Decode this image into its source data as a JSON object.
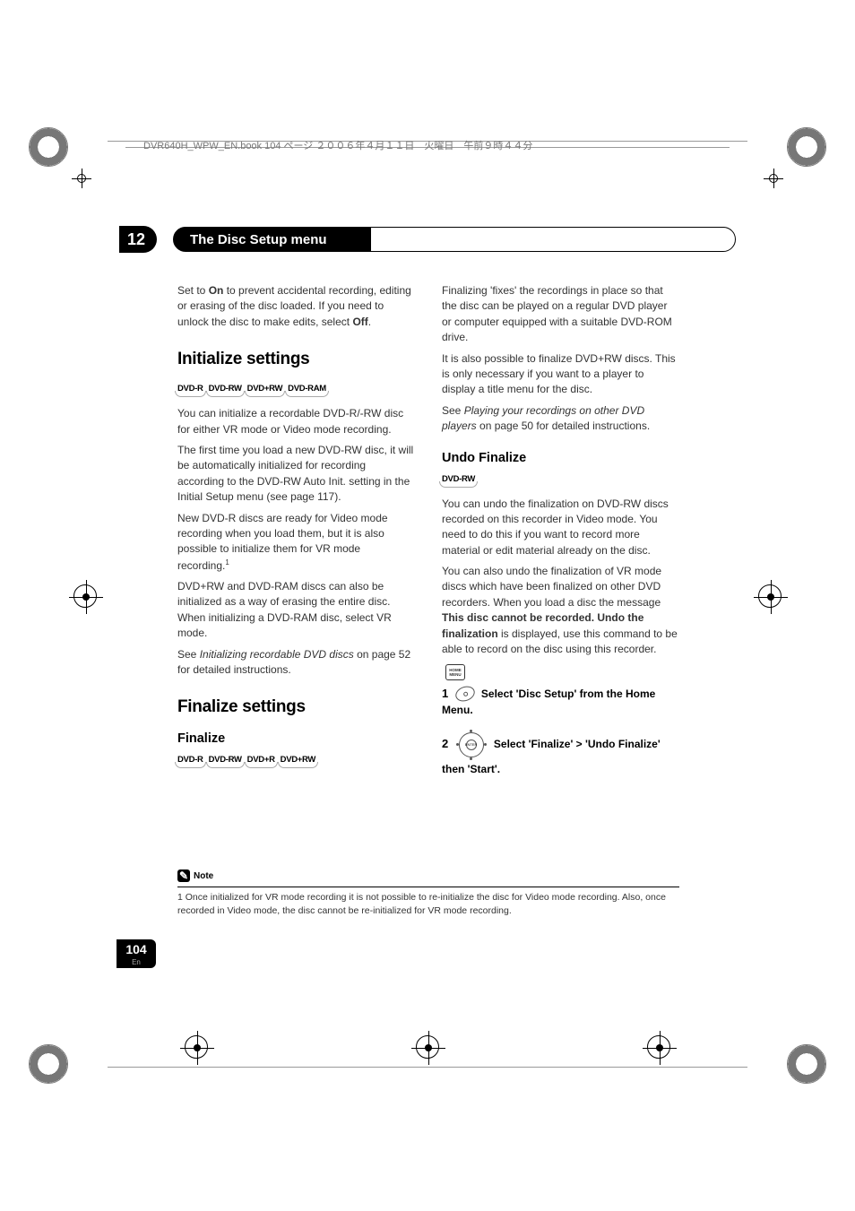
{
  "file_header": "DVR640H_WPW_EN.book  104 ページ   ２００６年４月１１日　火曜日　午前９時４４分",
  "chapter": {
    "number": "12",
    "title": "The Disc Setup menu"
  },
  "left_col": {
    "p1_a": "Set to ",
    "p1_on": "On",
    "p1_b": " to prevent accidental recording, editing or erasing of the disc loaded. If you need to unlock the disc to make edits, select ",
    "p1_off": "Off",
    "p1_c": ".",
    "h1a": "Initialize settings",
    "tags1": [
      "DVD-R",
      "DVD-RW",
      "DVD+RW",
      "DVD-RAM"
    ],
    "p2": "You can initialize a recordable DVD-R/-RW disc for either VR mode or Video mode recording.",
    "p3": "The first time you load a new DVD-RW disc, it will be automatically initialized for recording according to the DVD-RW Auto Init. setting in the Initial Setup menu (see page 117).",
    "p4_a": "New DVD-R discs are ready for Video mode recording when you load them, but it is also possible to initialize them for VR mode recording.",
    "p4_sup": "1",
    "p5": "DVD+RW and DVD-RAM discs can also be initialized as a way of erasing the entire disc. When initializing a DVD-RAM disc, select VR mode.",
    "p6_a": "See ",
    "p6_i": "Initializing recordable DVD discs",
    "p6_b": " on page 52 for detailed instructions.",
    "h1b": "Finalize settings",
    "h2a": "Finalize",
    "tags2": [
      "DVD-R",
      "DVD-RW",
      "DVD+R",
      "DVD+RW"
    ]
  },
  "right_col": {
    "p1": "Finalizing 'fixes' the recordings in place so that the disc can be played on a regular DVD player or computer equipped with a suitable DVD-ROM drive.",
    "p2": "It is also possible to finalize DVD+RW discs. This is only necessary if you want to a player to display a title menu for the disc.",
    "p3_a": "See ",
    "p3_i": "Playing your recordings on other DVD players",
    "p3_b": " on page 50 for detailed instructions.",
    "h2a": "Undo Finalize",
    "tags1": [
      "DVD-RW"
    ],
    "p4": "You can undo the finalization on DVD-RW discs recorded on this recorder in Video mode. You need to do this if you want to record more material or edit material already on the disc.",
    "p5_a": "You can also undo the finalization of VR mode discs which have been finalized on other DVD recorders. When you load a disc the message ",
    "p5_b1": "This disc cannot be recorded. Undo the finalization",
    "p5_b": " is displayed, use this command to be able to record on the disc using this recorder.",
    "step1_num": "1",
    "step1_text": "Select 'Disc Setup' from the Home Menu.",
    "step2_num": "2",
    "step2_text": "Select 'Finalize' > 'Undo Finalize' then 'Start'.",
    "nav_center": "ENTER"
  },
  "footnote": {
    "label": "Note",
    "text": "1  Once initialized for VR mode recording it is not possible to re-initialize the disc for Video mode recording. Also, once recorded in Video mode, the disc cannot be re-initialized for VR mode recording."
  },
  "page": {
    "number": "104",
    "lang": "En"
  }
}
